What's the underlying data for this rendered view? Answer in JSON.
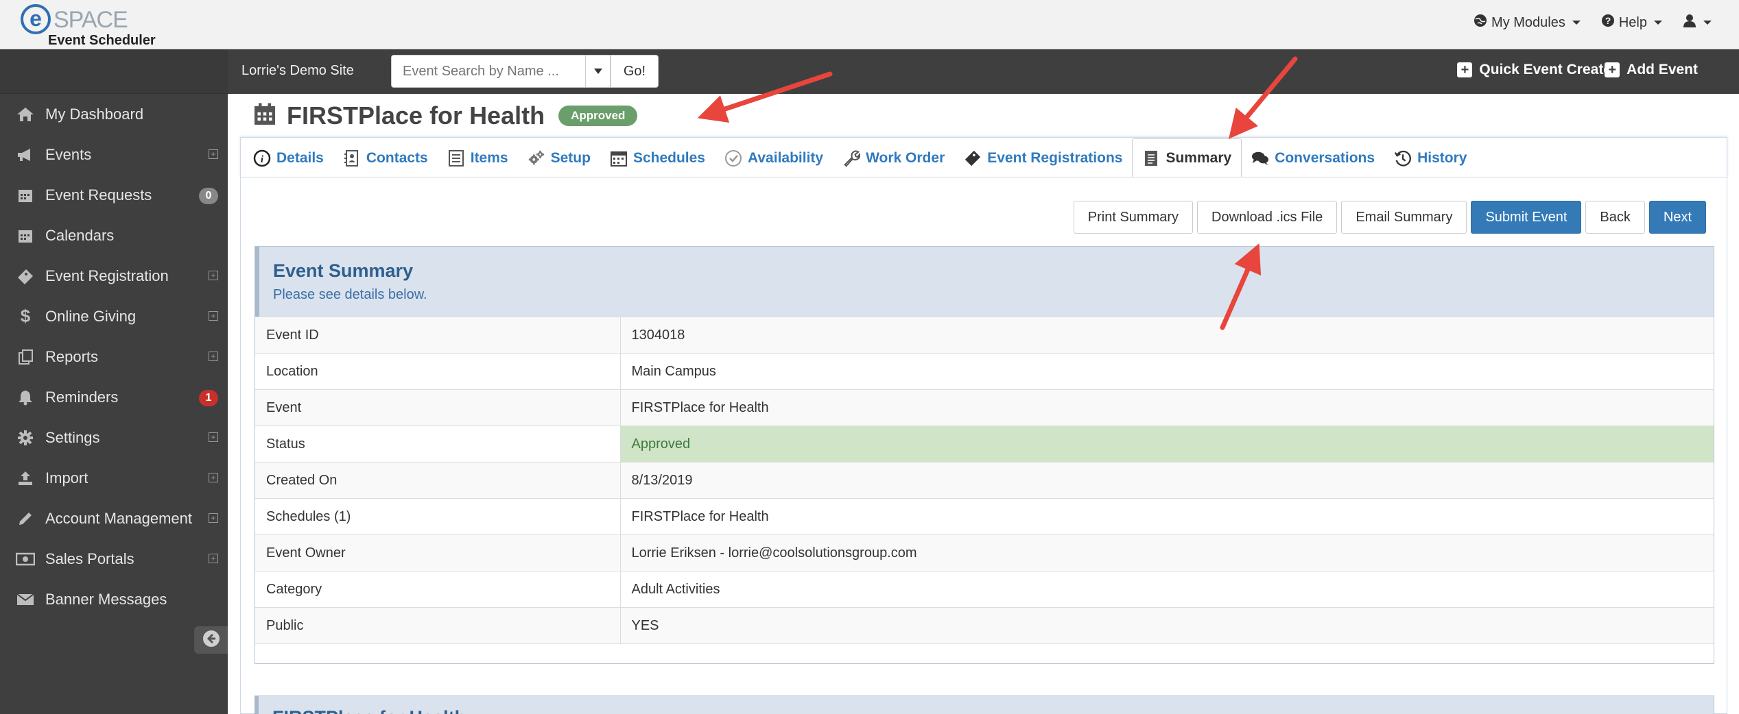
{
  "header": {
    "logo_letter": "e",
    "logo_word": "SPACE",
    "app_name": "Event Scheduler",
    "nav": [
      {
        "label": "My Modules",
        "icon": "globe-icon"
      },
      {
        "label": "Help",
        "icon": "question-circle-icon"
      },
      {
        "label": "",
        "icon": "user-icon"
      }
    ]
  },
  "subheader": {
    "site_name": "Lorrie's Demo Site",
    "search_placeholder": "Event Search by Name ...",
    "go_label": "Go!",
    "quick_event_label": "Quick Event Create",
    "add_event_label": "Add Event"
  },
  "sidebar": {
    "items": [
      {
        "label": "My Dashboard",
        "icon": "home-icon"
      },
      {
        "label": "Events",
        "icon": "megaphone-icon",
        "expand": "+"
      },
      {
        "label": "Event Requests",
        "icon": "calendar-icon",
        "badge": "0"
      },
      {
        "label": "Calendars",
        "icon": "calendar-icon"
      },
      {
        "label": "Event Registration",
        "icon": "ticket-icon",
        "expand": "+"
      },
      {
        "label": "Online Giving",
        "icon": "dollar-icon",
        "expand": "+"
      },
      {
        "label": "Reports",
        "icon": "reports-icon",
        "expand": "+"
      },
      {
        "label": "Reminders",
        "icon": "bell-icon",
        "badge": "1"
      },
      {
        "label": "Settings",
        "icon": "gear-icon",
        "expand": "+"
      },
      {
        "label": "Import",
        "icon": "upload-icon",
        "expand": "+"
      },
      {
        "label": "Account Management",
        "icon": "pencil-icon",
        "expand": "+"
      },
      {
        "label": "Sales Portals",
        "icon": "money-icon",
        "expand": "+"
      },
      {
        "label": "Banner Messages",
        "icon": "envelope-icon"
      }
    ]
  },
  "page": {
    "title": "FIRSTPlace for Health",
    "status": "Approved"
  },
  "tabs": [
    {
      "label": "Details",
      "icon": "info-icon"
    },
    {
      "label": "Contacts",
      "icon": "address-book-icon"
    },
    {
      "label": "Items",
      "icon": "list-icon"
    },
    {
      "label": "Setup",
      "icon": "gears-icon"
    },
    {
      "label": "Schedules",
      "icon": "calendar-grid-icon"
    },
    {
      "label": "Availability",
      "icon": "check-clock-icon"
    },
    {
      "label": "Work Order",
      "icon": "wrench-icon"
    },
    {
      "label": "Event Registrations",
      "icon": "ticket-icon"
    },
    {
      "label": "Summary",
      "icon": "document-icon",
      "active": true
    },
    {
      "label": "Conversations",
      "icon": "chat-icon"
    },
    {
      "label": "History",
      "icon": "history-icon"
    }
  ],
  "actions": {
    "print": "Print Summary",
    "download": "Download .ics File",
    "email": "Email Summary",
    "submit": "Submit Event",
    "back": "Back",
    "next": "Next"
  },
  "summary": {
    "heading": "Event Summary",
    "subheading": "Please see details below.",
    "rows": [
      {
        "key": "Event ID",
        "value": "1304018"
      },
      {
        "key": "Location",
        "value": "Main Campus"
      },
      {
        "key": "Event",
        "value": "FIRSTPlace for Health"
      },
      {
        "key": "Status",
        "value": "Approved"
      },
      {
        "key": "Created On",
        "value": "8/13/2019"
      },
      {
        "key": "Schedules (1)",
        "value": "FIRSTPlace for Health"
      },
      {
        "key": "Event Owner",
        "value": "Lorrie Eriksen - lorrie@coolsolutionsgroup.com"
      },
      {
        "key": "Category",
        "value": "Adult Activities"
      },
      {
        "key": "Public",
        "value": "YES"
      }
    ]
  },
  "second_section": {
    "heading": "FIRSTPlace for Health"
  },
  "colors": {
    "accent": "#337ab7",
    "sidebar_bg": "#3f3f3f",
    "status_ok": "#d0e4c8",
    "annotation_arrow": "#e8453c"
  }
}
